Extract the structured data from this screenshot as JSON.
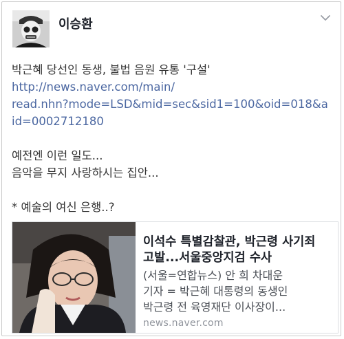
{
  "post": {
    "author": "이승환",
    "status_lines": [
      "박근혜 당선인 동생, 불법 음원 유통 '구설'"
    ],
    "link_lines": [
      "http://news.naver.com/main/",
      "read.nhn?mode=LSD&mid=sec&sid1=100&oid=018&a",
      "id=0002712180"
    ],
    "comment_lines": [
      "예전엔 이런 일도...",
      "음악을 무지 사랑하시는 집안..."
    ],
    "footnote": "* 예술의 여신 은행..?"
  },
  "link_card": {
    "title_lines": [
      "이석수 특별감찰관, 박근령 사기죄",
      "고발...서울중앙지검 수사"
    ],
    "desc_lines": [
      "(서울=연합뉴스) 안 희 차대운",
      "기자 = 박근혜 대통령의 동생인",
      "박근령 전 육영재단 이사장이..."
    ],
    "domain": "news.naver.com"
  },
  "colors": {
    "link": "#4b67a1",
    "text": "#333333",
    "muted": "#90949c"
  },
  "icons": {
    "menu": "chevron-down-icon"
  }
}
